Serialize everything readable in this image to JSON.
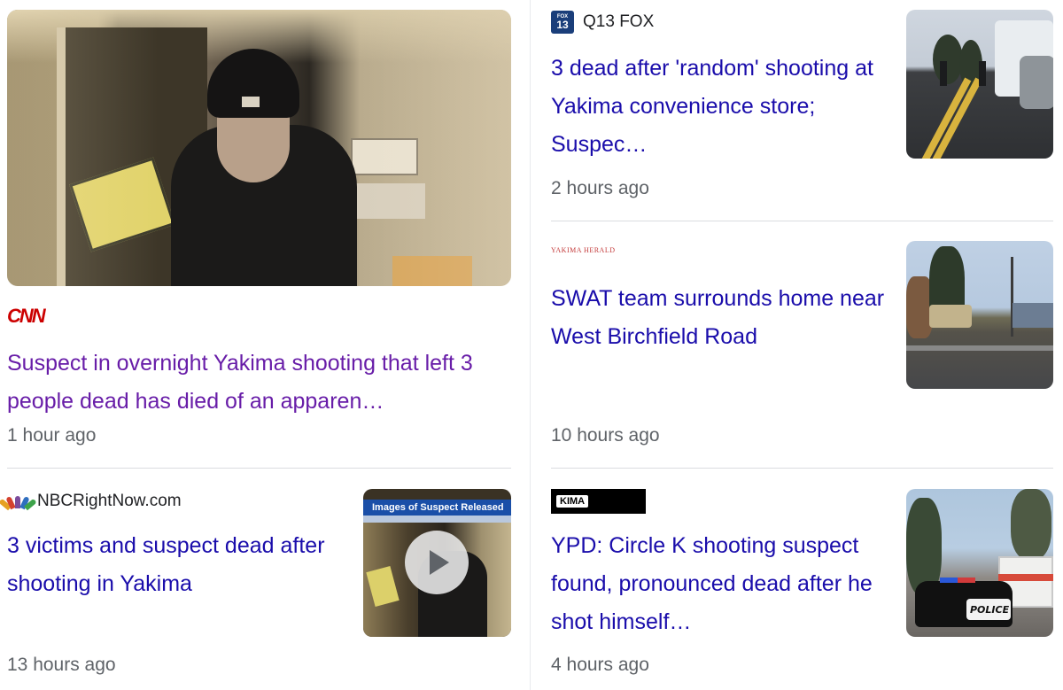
{
  "cards": {
    "cnn": {
      "source": "CNN",
      "headline": "Suspect in overnight Yakima shooting that left 3 people dead has died of an apparen…",
      "time": "1 hour ago"
    },
    "q13": {
      "source": "Q13 FOX",
      "logo_top": "FOX",
      "logo_bottom": "13",
      "headline": "3 dead after 'random' shooting at Yakima convenience store; Suspec…",
      "time": "2 hours ago"
    },
    "yh": {
      "source": "YAKIMA HERALD",
      "headline": "SWAT team surrounds home near West Birchfield Road",
      "time": "10 hours ago"
    },
    "nbc": {
      "source": "NBCRightNow.com",
      "headline": "3 victims and suspect dead after shooting in Yakima",
      "time": "13 hours ago",
      "thumb_banner": "Images of Suspect Released"
    },
    "kima": {
      "source": "KIMA",
      "headline": "YPD: Circle K shooting suspect found, pronounced dead after he shot himself…",
      "time": "4 hours ago",
      "thumb_badge": "POLICE"
    }
  },
  "colors": {
    "link": "#1a0dab",
    "visited_link": "#681da8",
    "meta": "#5f6368",
    "cnn_red": "#cc0000"
  }
}
